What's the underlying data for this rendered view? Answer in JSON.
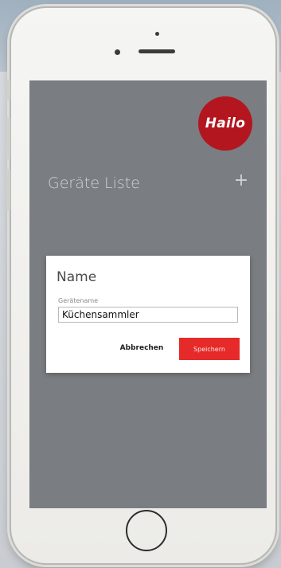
{
  "app": {
    "logo_text": "Hailo",
    "page_title": "Geräte Liste",
    "add_icon_glyph": "+"
  },
  "dialog": {
    "title": "Name",
    "field_label": "Gerätename",
    "field_value": "Küchensammler",
    "cancel_label": "Abbrechen",
    "save_label": "Speichern"
  },
  "colors": {
    "screen_overlay": "#7a7d81",
    "brand_red": "#b3161e",
    "save_button": "#e62a2a"
  },
  "icons": {
    "add": "plus-icon",
    "home": "home-button"
  }
}
